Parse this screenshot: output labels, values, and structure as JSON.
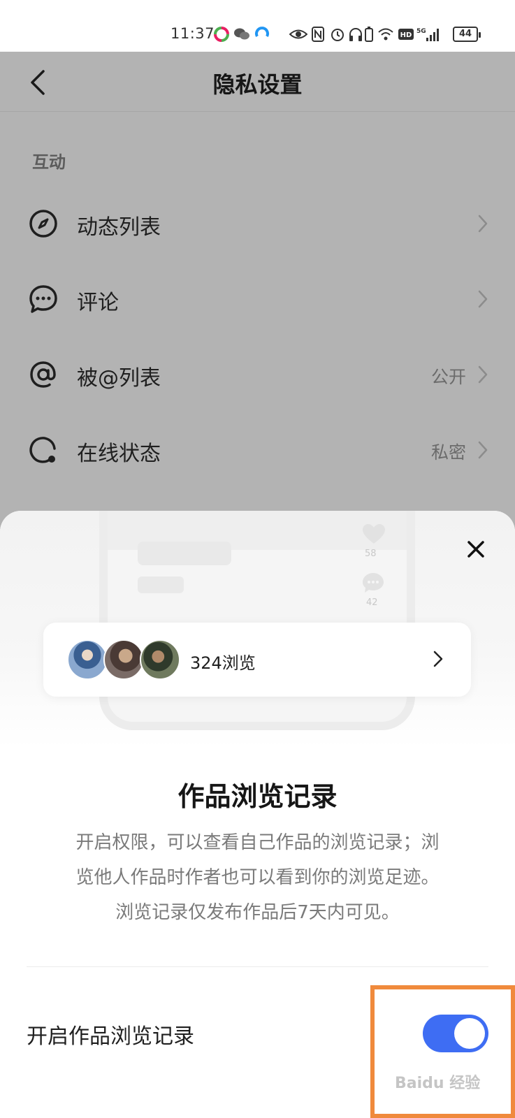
{
  "status_bar": {
    "time": "11:37",
    "battery": "44",
    "icons": [
      "app-icon-1",
      "wechat-icon",
      "app-icon-2",
      "eye-icon",
      "nfc-icon",
      "alarm-icon",
      "headphones-icon",
      "battery-small-icon",
      "wifi-icon",
      "hd-icon",
      "5g-signal-icon"
    ]
  },
  "header": {
    "back_icon": "chevron-left-icon",
    "title": "隐私设置"
  },
  "section": {
    "label": "互动"
  },
  "rows": [
    {
      "icon": "compass-icon",
      "label": "动态列表",
      "value": ""
    },
    {
      "icon": "comment-icon",
      "label": "评论",
      "value": ""
    },
    {
      "icon": "at-icon",
      "label": "被@列表",
      "value": "公开"
    },
    {
      "icon": "online-status-icon",
      "label": "在线状态",
      "value": "私密"
    }
  ],
  "sheet": {
    "illustration": {
      "heart_count": "58",
      "comment_count": "42"
    },
    "card": {
      "count_text": "324浏览"
    },
    "title": "作品浏览记录",
    "description_lines": [
      "开启权限，可以查看自己作品的浏览记录；浏",
      "览他人作品时作者也可以看到你的浏览足迹。",
      "浏览记录仅发布作品后7天内可见。"
    ],
    "toggle_label": "开启作品浏览记录",
    "toggle_on": true
  },
  "watermark": "Baidu 经验",
  "colors": {
    "accent": "#3e6df3",
    "highlight": "#f08a3c",
    "dim_overlay": "#b3b3b3"
  }
}
